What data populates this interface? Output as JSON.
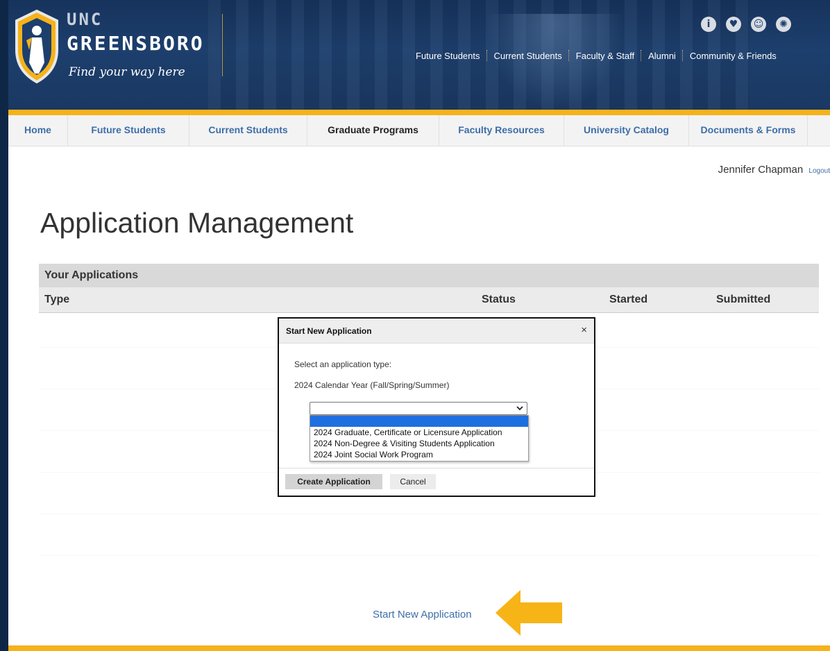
{
  "brand": {
    "line1": "UNC",
    "line2": "GREENSBORO",
    "tagline": "Find your way here"
  },
  "header_icons": [
    {
      "name": "info-icon",
      "glyph": "i"
    },
    {
      "name": "heart-hand-icon",
      "glyph": "♥"
    },
    {
      "name": "person-icon",
      "glyph": "☺"
    },
    {
      "name": "globe-icon",
      "glyph": "✺"
    }
  ],
  "audience_nav": [
    "Future Students",
    "Current Students",
    "Faculty & Staff",
    "Alumni",
    "Community & Friends"
  ],
  "main_nav": [
    "Home",
    "Future Students",
    "Current Students",
    "Graduate Programs",
    "Faculty Resources",
    "University Catalog",
    "Documents & Forms"
  ],
  "main_nav_active": "Graduate Programs",
  "user": {
    "name": "Jennifer Chapman",
    "logout": "Logout"
  },
  "page_title": "Application Management",
  "applications": {
    "caption": "Your Applications",
    "columns": [
      "Type",
      "Status",
      "Started",
      "Submitted"
    ]
  },
  "modal": {
    "title": "Start New Application",
    "close": "×",
    "prompt": "Select an application type:",
    "year_label": "2024 Calendar Year (Fall/Spring/Summer)",
    "selected_value": "",
    "options": [
      "2024 Graduate, Certificate or Licensure Application",
      "2024 Non-Degree & Visiting Students Application",
      "2024 Joint Social Work Program"
    ],
    "create_button": "Create Application",
    "cancel_button": "Cancel"
  },
  "start_link": "Start New Application",
  "colors": {
    "navy": "#1d3f6d",
    "gold": "#f5b21a",
    "link_blue": "#3d6ea8"
  }
}
